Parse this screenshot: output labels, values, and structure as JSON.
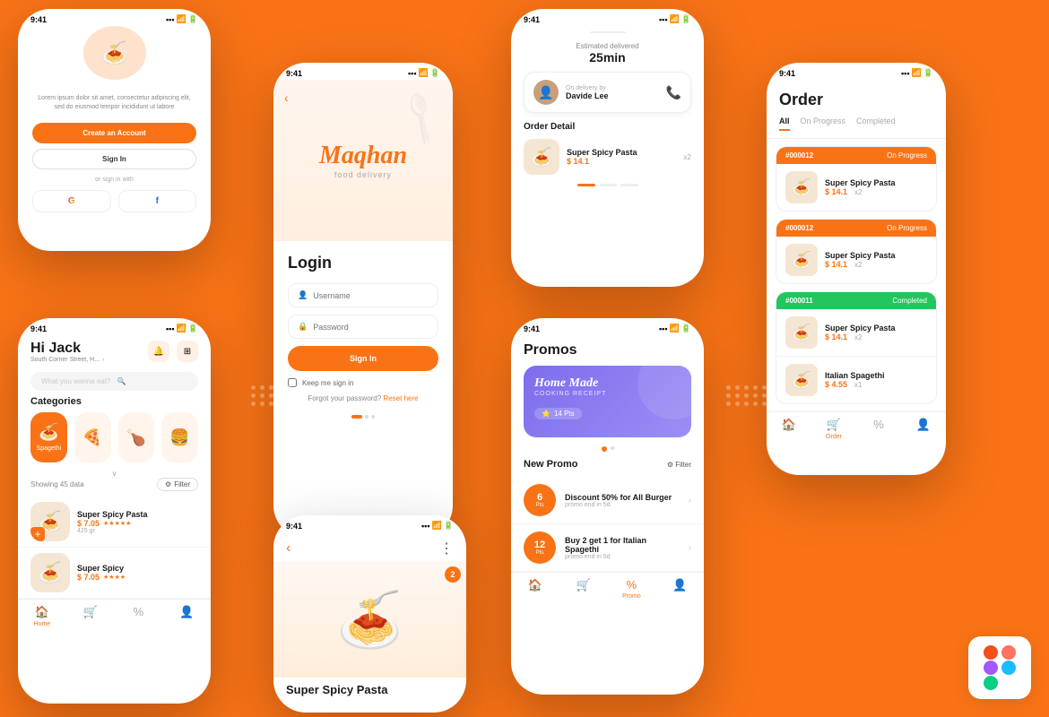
{
  "phones": {
    "signin": {
      "lorem": "Lorem ipsum dolor sit amet, consectetur adipiscing elit, sed do eiusmod tempor incididunt ut labore",
      "create_btn": "Create an Account",
      "signin_btn": "Sign In",
      "or_text": "or sign in with",
      "google_label": "G",
      "fb_label": "f"
    },
    "login": {
      "brand": "Maqhan",
      "sub": "food delivery",
      "title": "Login",
      "username_placeholder": "Username",
      "password_placeholder": "Password",
      "signin_btn": "Sign In",
      "keep_signin": "Keep me sign in",
      "forgot_text": "Forgot your password?",
      "reset_link": "Reset here"
    },
    "home": {
      "time": "9:41",
      "greeting": "Hi Jack",
      "address": "South Corner Street, H...",
      "search_placeholder": "What you wanna eat?",
      "categories_label": "Categories",
      "categories": [
        {
          "name": "Spagethi",
          "icon": "🍝"
        },
        {
          "name": "Pizza",
          "icon": "🍕"
        },
        {
          "name": "Chicken",
          "icon": "🍗"
        },
        {
          "name": "Burger",
          "icon": "🍔"
        }
      ],
      "showing_text": "Showing 45 data",
      "filter_btn": "Filter",
      "foods": [
        {
          "name": "Super Spicy Pasta",
          "price": "$ 7.05",
          "weight": "425 gr",
          "stars": "★★★★★"
        },
        {
          "name": "Super Spicy",
          "price": "$ 7.05",
          "stars": "★★★★"
        }
      ],
      "nav": [
        "Home",
        "Cart",
        "%",
        "Profile"
      ]
    },
    "order_detail": {
      "time": "9:41",
      "estimated_label": "Estimated delivered",
      "estimated_time": "25min",
      "delivery_label": "On delivery by",
      "driver_name": "Davide Lee",
      "order_detail_label": "Order Detail",
      "food_name": "Super Spicy Pasta",
      "food_price": "$ 14.1",
      "food_qty": "x2"
    },
    "food_detail": {
      "time": "9:41",
      "food_name": "Super Spicy Pasta",
      "cart_count": "2"
    },
    "promos": {
      "time": "9:41",
      "title": "Promos",
      "banner_title": "Home Made",
      "banner_sub": "COOKING RECEIPT",
      "banner_pts": "14 Pts",
      "new_promo_label": "New Promo",
      "filter_label": "Filter",
      "promos_list": [
        {
          "pts": "6",
          "title": "Discount 50% for All Burger",
          "end": "promo end in 5d"
        },
        {
          "pts": "12",
          "title": "Buy 2 get 1 for Italian Spagethi",
          "end": "promo end in 5d"
        }
      ],
      "nav": [
        "Home",
        "Cart",
        "Promo",
        "Profile"
      ]
    },
    "orders": {
      "time": "9:41",
      "title": "Order",
      "tabs": [
        "All",
        "On Progress",
        "Completed"
      ],
      "active_tab": "All",
      "orders": [
        {
          "num": "#000012",
          "status": "On Progress",
          "status_color": "orange",
          "items": [
            {
              "name": "Super Spicy Pasta",
              "price": "$ 14.1",
              "qty": "x2"
            }
          ]
        },
        {
          "num": "#000012",
          "status": "On Progress",
          "status_color": "orange",
          "items": [
            {
              "name": "Super Spicy Pasta",
              "price": "$ 14.1",
              "qty": "x2"
            }
          ]
        },
        {
          "num": "#000011",
          "status": "Completed",
          "status_color": "green",
          "items": [
            {
              "name": "Super Spicy Pasta",
              "price": "$ 14.1",
              "qty": "x2"
            },
            {
              "name": "Italian Spagethi",
              "price": "$ 4.55",
              "qty": "x1"
            }
          ]
        }
      ],
      "nav": [
        "Home",
        "Order",
        "%",
        "Profile"
      ]
    }
  },
  "figma": {
    "label": "Figma"
  }
}
